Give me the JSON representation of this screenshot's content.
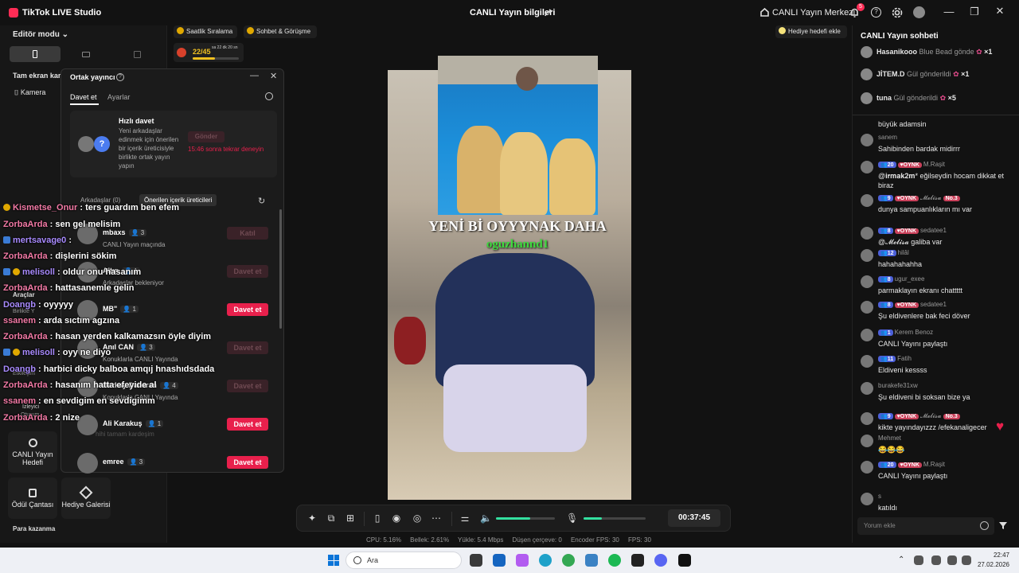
{
  "app": {
    "title": "TikTok LIVE Studio"
  },
  "header": {
    "center_title": "CANLI Yayın bilgileri",
    "center_link": "CANLI Yayın Merkezi",
    "notif_badge": "5"
  },
  "left": {
    "editor_mode": "Editör modu",
    "full_screen": "Tam ekran kam",
    "camera": "Kamera",
    "tools": "Araçlar",
    "tools_sub": "Birlikte Y",
    "interaction": "Etkileşim",
    "viewer": "İzleyici",
    "viewer_sub": "Oturum",
    "tiles": [
      {
        "label": "CANLI Yayın Hedefi"
      },
      {
        "label": "Ödül Çantası"
      },
      {
        "label": "Hediye Galerisi"
      }
    ],
    "earn": "Para kazanma"
  },
  "topchips": {
    "hourly": "Saatlik Sıralama",
    "chat_meet": "Sohbet & Görüşme",
    "goal_progress": "22/45",
    "goal_progress_fraction": 0.49,
    "goal_time": "sa 22 dk 20 sn",
    "gift_goal": "Hediye hedefi ekle"
  },
  "cohost": {
    "title": "Ortak yayıncı",
    "tab_invite": "Davet et",
    "tab_settings": "Ayarlar",
    "quick_title": "Hızlı davet",
    "quick_desc": "Yeni arkadaşlar edinmek için önerilen bir içerik üreticisiyle birlikte ortak yayın yapın",
    "quick_btn": "Gönder",
    "quick_retry": "15:46 sonra tekrar deneyin",
    "tab_friends": "Arkadaşlar (0)",
    "tab_suggested": "Önerilen içerik üreticileri",
    "rows": [
      {
        "name": "mbaxs",
        "count": "3",
        "sub": "CANLI Yayın maçında",
        "btn": "Katıl",
        "on": false
      },
      {
        "name": "Altın",
        "count": "1",
        "sub": "Arkadaşlar bekleniyor",
        "btn": "Davet et",
        "on": false
      },
      {
        "name": "MB\"",
        "count": "1",
        "sub": "",
        "btn": "Davet et",
        "on": true
      },
      {
        "name": "Anıl CAN",
        "count": "3",
        "sub": "Konuklarla CANLI Yayında",
        "btn": "Davet et",
        "on": false
      },
      {
        "name": "Berkay Dalkıran",
        "count": "4",
        "sub": "Konuklarla CANLI Yayında",
        "btn": "Davet et",
        "on": false
      },
      {
        "name": "Ali Karakuş",
        "count": "1",
        "sub": "",
        "btn": "Davet et",
        "on": true
      },
      {
        "name": "emree",
        "count": "3",
        "sub": "",
        "btn": "Davet et",
        "on": true
      }
    ]
  },
  "overlay_chat": [
    {
      "user": "Kismetse_Onur",
      "text": "ters guardım ben efem",
      "color": "u",
      "badge": "y"
    },
    {
      "user": "ZorbaArda",
      "text": "sen gel melisim",
      "color": "u",
      "badge": ""
    },
    {
      "user": "mertsavage0",
      "text": "",
      "color": "u2",
      "badge": "b"
    },
    {
      "user": "ZorbaArda",
      "text": "dişlerini sökim",
      "color": "u",
      "badge": ""
    },
    {
      "user": "melisoll",
      "text": "oldur onu hasanım",
      "color": "u2",
      "badge": "by"
    },
    {
      "user": "ZorbaArda",
      "text": "hattasanemle gelin",
      "color": "u",
      "badge": ""
    },
    {
      "user": "Doangb",
      "text": "oyyyyy",
      "color": "u2",
      "badge": ""
    },
    {
      "user": "ssanem",
      "text": "arda sıctım agzına",
      "color": "u",
      "badge": ""
    },
    {
      "user": "ZorbaArda",
      "text": "hasan yerden kalkamazsın öyle diyim",
      "color": "u",
      "badge": ""
    },
    {
      "user": "melisoll",
      "text": "oyy ne diyo",
      "color": "u2",
      "badge": "by"
    },
    {
      "user": "Doangb",
      "text": "harbici dicky balboa amqıj hnashıdsdada",
      "color": "u2",
      "badge": ""
    },
    {
      "user": "ZorbaArda",
      "text": "hasanım hatta efeyide al",
      "color": "u",
      "badge": ""
    },
    {
      "user": "ssanem",
      "text": "en sevdigim en sevdigimm",
      "color": "u",
      "badge": ""
    },
    {
      "user": "ZorbaArda",
      "text": "2 nize",
      "color": "u",
      "badge": ""
    }
  ],
  "overlay_faint": "hihi tamam kardeşim",
  "preview": {
    "title": "YENİ Bİ OYYYNAK DAHA",
    "subtitle": "oguzhannd1"
  },
  "chat": {
    "title": "CANLI Yayın sohbeti",
    "gifts": [
      {
        "user": "Hasanikooo",
        "action": "Blue Bead gönde",
        "mult": "×1"
      },
      {
        "user": "JİTEM.D",
        "action": "Gül gönderildi",
        "mult": "×1"
      },
      {
        "user": "tuna",
        "action": "Gül gönderildi",
        "mult": "×5"
      }
    ],
    "messages": [
      {
        "name": "",
        "msg": "büyük adamsin"
      },
      {
        "name": "sanem",
        "msg": "Sahibinden bardak midirrr"
      },
      {
        "name": "M.Raşit",
        "lv": "20",
        "ok": "OYNK",
        "msg": "@𝐢𝐫𝐦𝐚𝐤𝟐𝐦* eğilseydin hocam dikkat et biraz"
      },
      {
        "name": "𝓜𝓮𝓵𝓲𝓼𝓪",
        "lv": "9",
        "ok": "OYNK",
        "no": "No.3",
        "msg": "dunya sampuanlıkların mı var"
      },
      {
        "name": "sedatee1",
        "lv": "8",
        "ok": "OYNK",
        "msg": "@𝓜𝓮𝓵𝓲𝓼𝓪 galiba var"
      },
      {
        "name": "hilâl",
        "lv": "12",
        "msg": "hahahahahha"
      },
      {
        "name": "ugur_exee",
        "lv": "8",
        "msg": "parmaklayın ekranı chattttt"
      },
      {
        "name": "sedatee1",
        "lv": "8",
        "ok": "OYNK",
        "msg": "Şu eldivenlere bak feci döver"
      },
      {
        "name": "Kerem Benoz",
        "lv": "1",
        "msg": "CANLI Yayını paylaştı"
      },
      {
        "name": "Fatih",
        "lv": "11",
        "msg": "Eldiveni kessss"
      },
      {
        "name": "burakefe31xw",
        "msg": "Şu eldiveni bi soksan bize ya"
      },
      {
        "name": "𝓜𝓮𝓵𝓲𝓼𝓪",
        "lv": "9",
        "ok": "OYNK",
        "no": "No.3",
        "msg": "kikte yayındayızzz /efekanaligecer"
      },
      {
        "name": "Mehmet",
        "msg": "😂😂😂"
      },
      {
        "name": "M.Raşit",
        "lv": "20",
        "ok": "OYNK",
        "msg": "CANLI Yayını paylaştı"
      },
      {
        "name": "s",
        "msg": "katıldı"
      }
    ],
    "placeholder": "Yorum ekle"
  },
  "controls": {
    "timer": "00:37:45",
    "volume_fraction": 0.58,
    "mic_fraction": 0.3
  },
  "stats": {
    "cpu": "CPU: 5.16%",
    "mem": "Bellek: 2.61%",
    "upload": "Yükle: 5.4 Mbps",
    "dropped": "Düşen çerçeve: 0",
    "encoder": "Encoder FPS: 30",
    "fps": "FPS: 30"
  },
  "taskbar": {
    "search": "Ara",
    "time": "22:47",
    "date": "27.02.2026"
  }
}
